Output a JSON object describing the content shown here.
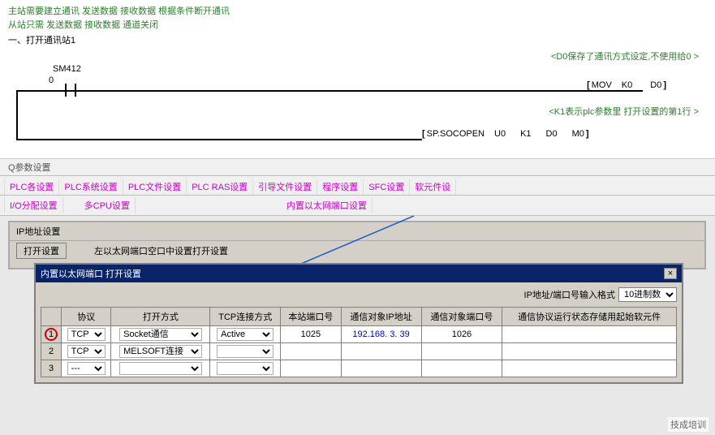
{
  "comments": {
    "line1": "主站需要建立通讯  发送数据  接收数据  根据条件断开通讯",
    "line2": "从站只需  发送数据  接收数据  通道关闭",
    "line3": "一、打开通讯站1"
  },
  "note_d0": "<D0保存了通讯方式设定,不使用给0",
  "note_arrow_right": ">",
  "note_k1": "<K1表示plc参数里 打开设置的第1行",
  "rung1": {
    "contact": "SM412",
    "address": "0",
    "instruction": "MOV",
    "args": "K0   D0"
  },
  "rung2": {
    "instruction": "SP.SOCOPEN",
    "args": "U0    K1    D0    M0"
  },
  "q_params_label": "Q参数设置",
  "tabs_row1": [
    "PLC各设置",
    "PLC系统设置",
    "PLC文件设置",
    "PLC RAS设置",
    "引导文件设置",
    "程序设置",
    "SFC设置",
    "软元件设"
  ],
  "tabs_row2_left": [
    "I/O分配设置",
    "多CPU设置"
  ],
  "tabs_row2_right": "内置以太网端口设置",
  "ip_panel": {
    "title": "IP地址设置",
    "btn_setup": "打开设置",
    "btn_right": "左以太网端口空口中设置打开设置"
  },
  "dialog": {
    "title": "内置以太网端口 打开设置",
    "close": "×",
    "format_label": "IP地址/端口号输入格式",
    "format_value": "10进制数",
    "columns": [
      "协议",
      "打开方式",
      "TCP连接方式",
      "本站端口号",
      "通信对象IP地址",
      "通信对象端口号",
      "通信协议运行状态存储用起始软元件"
    ],
    "rows": [
      {
        "num": "1",
        "highlight": true,
        "protocol": "TCP",
        "open_mode": "Socket通信",
        "tcp_conn": "Active",
        "local_port": "1025",
        "remote_ip": "192.168. 3. 39",
        "remote_port": "1026",
        "device": ""
      },
      {
        "num": "2",
        "highlight": false,
        "protocol": "TCP",
        "open_mode": "MELSOFT连接",
        "tcp_conn": "",
        "local_port": "",
        "remote_ip": "",
        "remote_port": "",
        "device": ""
      },
      {
        "num": "3",
        "highlight": false,
        "protocol": "---",
        "open_mode": "",
        "tcp_conn": "",
        "local_port": "",
        "remote_ip": "",
        "remote_port": "",
        "device": ""
      }
    ]
  },
  "watermark": "技成培训"
}
